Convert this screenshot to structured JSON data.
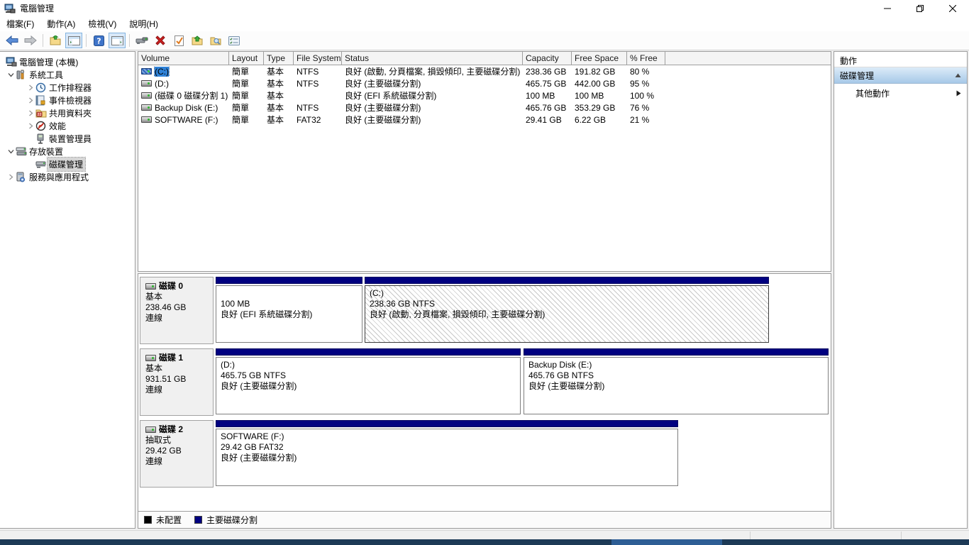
{
  "window": {
    "title": "電腦管理"
  },
  "menubar": {
    "items": [
      {
        "label": "檔案(F)"
      },
      {
        "label": "動作(A)"
      },
      {
        "label": "檢視(V)"
      },
      {
        "label": "說明(H)"
      }
    ]
  },
  "sidebar": {
    "items": [
      {
        "label": "電腦管理 (本機)"
      },
      {
        "label": "系統工具"
      },
      {
        "label": "工作排程器"
      },
      {
        "label": "事件檢視器"
      },
      {
        "label": "共用資料夾"
      },
      {
        "label": "效能"
      },
      {
        "label": "裝置管理員"
      },
      {
        "label": "存放裝置"
      },
      {
        "label": "磁碟管理"
      },
      {
        "label": "服務與應用程式"
      }
    ]
  },
  "volume_table": {
    "columns": [
      "Volume",
      "Layout",
      "Type",
      "File System",
      "Status",
      "Capacity",
      "Free Space",
      "% Free"
    ],
    "rows": [
      {
        "volume": "(C:)",
        "layout": "簡單",
        "type": "基本",
        "fs": "NTFS",
        "status": "良好 (啟動, 分頁檔案, 損毀傾印, 主要磁碟分割)",
        "capacity": "238.36 GB",
        "free": "191.82 GB",
        "pct": "80 %"
      },
      {
        "volume": "(D:)",
        "layout": "簡單",
        "type": "基本",
        "fs": "NTFS",
        "status": "良好 (主要磁碟分割)",
        "capacity": "465.75 GB",
        "free": "442.00 GB",
        "pct": "95 %"
      },
      {
        "volume": "(磁碟 0 磁碟分割 1)",
        "layout": "簡單",
        "type": "基本",
        "fs": "",
        "status": "良好 (EFI 系統磁碟分割)",
        "capacity": "100 MB",
        "free": "100 MB",
        "pct": "100 %"
      },
      {
        "volume": "Backup Disk (E:)",
        "layout": "簡單",
        "type": "基本",
        "fs": "NTFS",
        "status": "良好 (主要磁碟分割)",
        "capacity": "465.76 GB",
        "free": "353.29 GB",
        "pct": "76 %"
      },
      {
        "volume": "SOFTWARE (F:)",
        "layout": "簡單",
        "type": "基本",
        "fs": "FAT32",
        "status": "良好 (主要磁碟分割)",
        "capacity": "29.41 GB",
        "free": "6.22 GB",
        "pct": "21 %"
      }
    ]
  },
  "disks": [
    {
      "name": "磁碟 0",
      "kind": "基本",
      "size": "238.46 GB",
      "state": "連線",
      "partitions": [
        {
          "line1": "",
          "line2": "100 MB",
          "line3": "良好 (EFI 系統磁碟分割)"
        },
        {
          "line1": "(C:)",
          "line2": "238.36 GB NTFS",
          "line3": "良好 (啟動, 分頁檔案, 損毀傾印, 主要磁碟分割)"
        }
      ]
    },
    {
      "name": "磁碟 1",
      "kind": "基本",
      "size": "931.51 GB",
      "state": "連線",
      "partitions": [
        {
          "line1": "(D:)",
          "line2": "465.75 GB NTFS",
          "line3": "良好 (主要磁碟分割)"
        },
        {
          "line1": "Backup Disk  (E:)",
          "line2": "465.76 GB NTFS",
          "line3": "良好 (主要磁碟分割)"
        }
      ]
    },
    {
      "name": "磁碟 2",
      "kind": "抽取式",
      "size": "29.42 GB",
      "state": "連線",
      "partitions": [
        {
          "line1": "SOFTWARE  (F:)",
          "line2": "29.42 GB FAT32",
          "line3": "良好 (主要磁碟分割)"
        }
      ]
    }
  ],
  "legend": {
    "unallocated": "未配置",
    "primary": "主要磁碟分割"
  },
  "actions": {
    "header": "動作",
    "group": "磁碟管理",
    "more": "其他動作"
  },
  "colors": {
    "primary_partition": "#000080",
    "unallocated": "#000000",
    "list_selection": "#2f82d8",
    "action_gradient_top": "#dcebf8",
    "action_gradient_bottom": "#a7c9e8",
    "taskbar": "#1d3a56",
    "taskbar_active": "#2e5e95",
    "tree_selection": "#d6d6d6"
  }
}
